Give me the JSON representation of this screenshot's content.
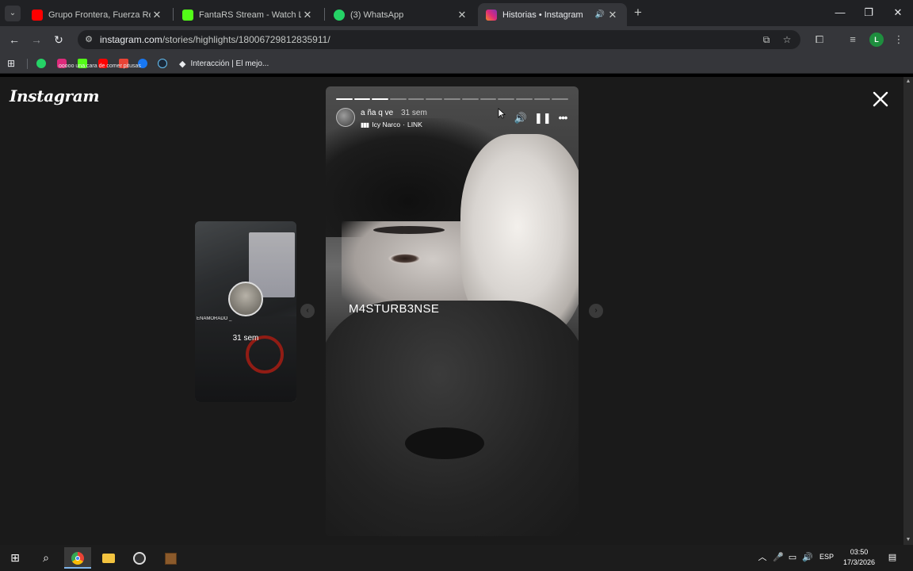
{
  "browser": {
    "tabs": [
      {
        "title": "Grupo Frontera, Fuerza Regida",
        "favicon": "youtube-icon",
        "color": "#ff0000",
        "active": false
      },
      {
        "title": "FantaRS Stream - Watch Live on",
        "favicon": "kick-icon",
        "color": "#53fc18",
        "active": false
      },
      {
        "title": "(3) WhatsApp",
        "favicon": "whatsapp-icon",
        "color": "#25d366",
        "active": false
      },
      {
        "title": "Historias • Instagram",
        "favicon": "instagram-icon",
        "color": "#e1306c",
        "active": true
      }
    ],
    "url_host": "instagram.com",
    "url_path": "/stories/highlights/18006729812835911/",
    "profile_initial": "L",
    "bookmarks": {
      "tiny_label": "ooooo una cara de comer pitusas",
      "interaccion": "Interacción | El mejo..."
    }
  },
  "instagram": {
    "logo": "Instagram",
    "prev_story": {
      "username": "ENAMORADO _",
      "time": "31 sem"
    },
    "story": {
      "username": "a ña q ve",
      "time": "31 sem",
      "music_title": "Icy Narco",
      "music_artist": "LINK",
      "music_sep": "·",
      "caption": "M4STURB3NSE",
      "progress_total": 13,
      "progress_done": 3
    }
  },
  "taskbar": {
    "language": "ESP",
    "time": "03:50",
    "date": "17/3/2026"
  }
}
